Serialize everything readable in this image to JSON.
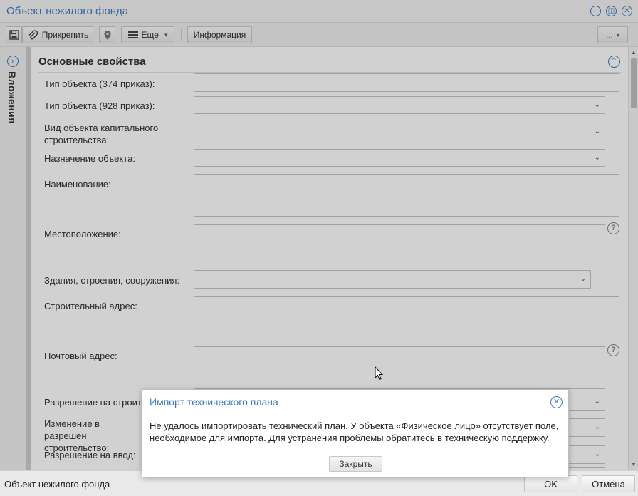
{
  "window": {
    "title": "Объект нежилого фонда"
  },
  "toolbar": {
    "attach_label": "Прикрепить",
    "more_label": "Еще",
    "info_label": "Информация",
    "overflow_label": "..."
  },
  "side_panel": {
    "label": "Вложения"
  },
  "section": {
    "title": "Основные свойства"
  },
  "fields": [
    {
      "label": "Тип объекта (374 приказ):",
      "value": ""
    },
    {
      "label": "Тип объекта (928 приказ):",
      "value": ""
    },
    {
      "label": "Вид объекта капитального строительства:",
      "value": ""
    },
    {
      "label": "Назначение объекта:",
      "value": ""
    },
    {
      "label": "Наименование:",
      "value": ""
    },
    {
      "label": "Местоположение:",
      "value": ""
    },
    {
      "label": "Здания, строения, сооружения:",
      "value": ""
    },
    {
      "label": "Строительный адрес:",
      "value": ""
    },
    {
      "label": "Почтовый адрес:",
      "value": ""
    },
    {
      "label": "Разрешение на строит",
      "value": ""
    },
    {
      "label": "Изменение в разрешен строительство:",
      "value": ""
    },
    {
      "label": "Разрешение на ввод:",
      "value": ""
    }
  ],
  "dialog": {
    "title": "Импорт технического плана",
    "message": "Не удалось импортировать технический план. У объекта «Физическое лицо» отсутствует поле, необходимое для импорта. Для устранения проблемы обратитесь в техническую поддержку.",
    "close_label": "Закрыть"
  },
  "bottom_bar": {
    "status": "Объект нежилого фонда",
    "ok_label": "OK",
    "cancel_label": "Отмена"
  },
  "colors": {
    "accent": "#3a7bbf",
    "border": "#c6c6c6",
    "background": "#f0f0f0"
  },
  "icons": [
    "minimize-icon",
    "restore-icon",
    "close-icon",
    "save-icon",
    "paperclip-icon",
    "location-pin-icon",
    "menu-icon",
    "chevron-down-icon",
    "expand-panel-icon",
    "collapse-section-icon",
    "help-icon",
    "dialog-close-icon"
  ]
}
